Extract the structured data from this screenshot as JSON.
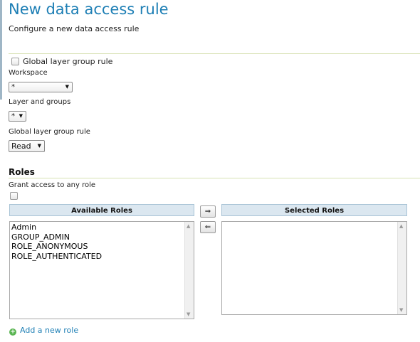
{
  "header": {
    "title": "New data access rule",
    "subtitle": "Configure a new data access rule"
  },
  "form": {
    "global_layer_group_checkbox_label": "Global layer group rule",
    "workspace_label": "Workspace",
    "workspace_value": "*",
    "layer_label": "Layer and groups",
    "layer_value": "*",
    "access_mode_label": "Global layer group rule",
    "access_mode_value": "Read"
  },
  "roles": {
    "heading": "Roles",
    "grant_any_label": "Grant access to any role",
    "available_header": "Available Roles",
    "selected_header": "Selected Roles",
    "available_items": [
      "Admin",
      "GROUP_ADMIN",
      "ROLE_ANONYMOUS",
      "ROLE_AUTHENTICATED"
    ],
    "selected_items": [],
    "add_right_label": "⇒",
    "add_left_label": "⇐",
    "add_role_label": "Add a new role"
  },
  "icons": {
    "select_arrow": "▼",
    "scroll_up": "▲",
    "scroll_down": "▼",
    "add_icon": "+"
  },
  "colors": {
    "title": "#1e7fb5",
    "link": "#1e7fb5",
    "header_bg": "#dbe7f0",
    "separator": "#d8e2b4",
    "add_icon": "#5ab552"
  }
}
